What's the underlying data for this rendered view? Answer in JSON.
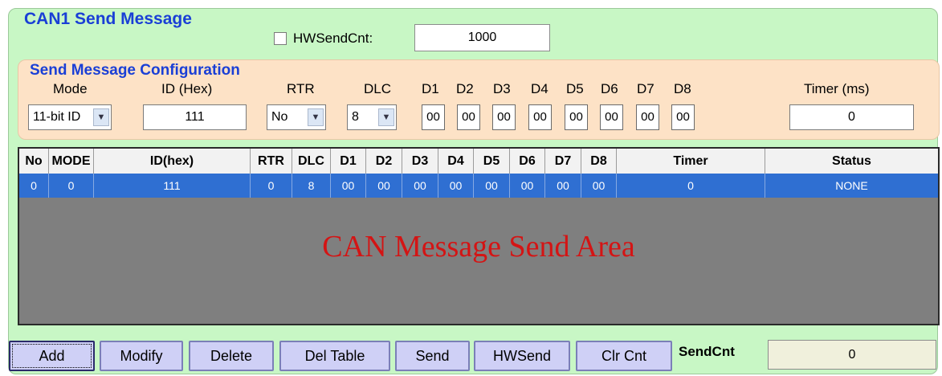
{
  "group_title": "CAN1 Send Message",
  "hw_send_cnt": {
    "label": "HWSendCnt:",
    "checked": false,
    "value": "1000"
  },
  "config": {
    "title": "Send Message Configuration",
    "labels": {
      "mode": "Mode",
      "id": "ID (Hex)",
      "rtr": "RTR",
      "dlc": "DLC",
      "d1": "D1",
      "d2": "D2",
      "d3": "D3",
      "d4": "D4",
      "d5": "D5",
      "d6": "D6",
      "d7": "D7",
      "d8": "D8",
      "timer": "Timer (ms)"
    },
    "mode_value": "11-bit ID",
    "id_value": "111",
    "rtr_value": "No",
    "dlc_value": "8",
    "d_values": [
      "00",
      "00",
      "00",
      "00",
      "00",
      "00",
      "00",
      "00"
    ],
    "timer_value": "0"
  },
  "table": {
    "headers": [
      "No",
      "MODE",
      "ID(hex)",
      "RTR",
      "DLC",
      "D1",
      "D2",
      "D3",
      "D4",
      "D5",
      "D6",
      "D7",
      "D8",
      "Timer",
      "Status"
    ],
    "rows": [
      [
        "0",
        "0",
        "111",
        "0",
        "8",
        "00",
        "00",
        "00",
        "00",
        "00",
        "00",
        "00",
        "00",
        "0",
        "NONE"
      ]
    ],
    "area_text": "CAN Message Send Area"
  },
  "buttons": [
    "Add",
    "Modify",
    "Delete",
    "Del Table",
    "Send",
    "HWSend",
    "Clr Cnt"
  ],
  "send_cnt": {
    "label": "SendCnt",
    "value": "0"
  },
  "colors": {
    "panel_bg": "#c8f7c5",
    "config_bg": "#fde2c6",
    "title_color": "#1a3fd6",
    "selected_row": "#2f6fd2",
    "area_text": "#d41414",
    "button_bg": "#cfd0f6"
  }
}
